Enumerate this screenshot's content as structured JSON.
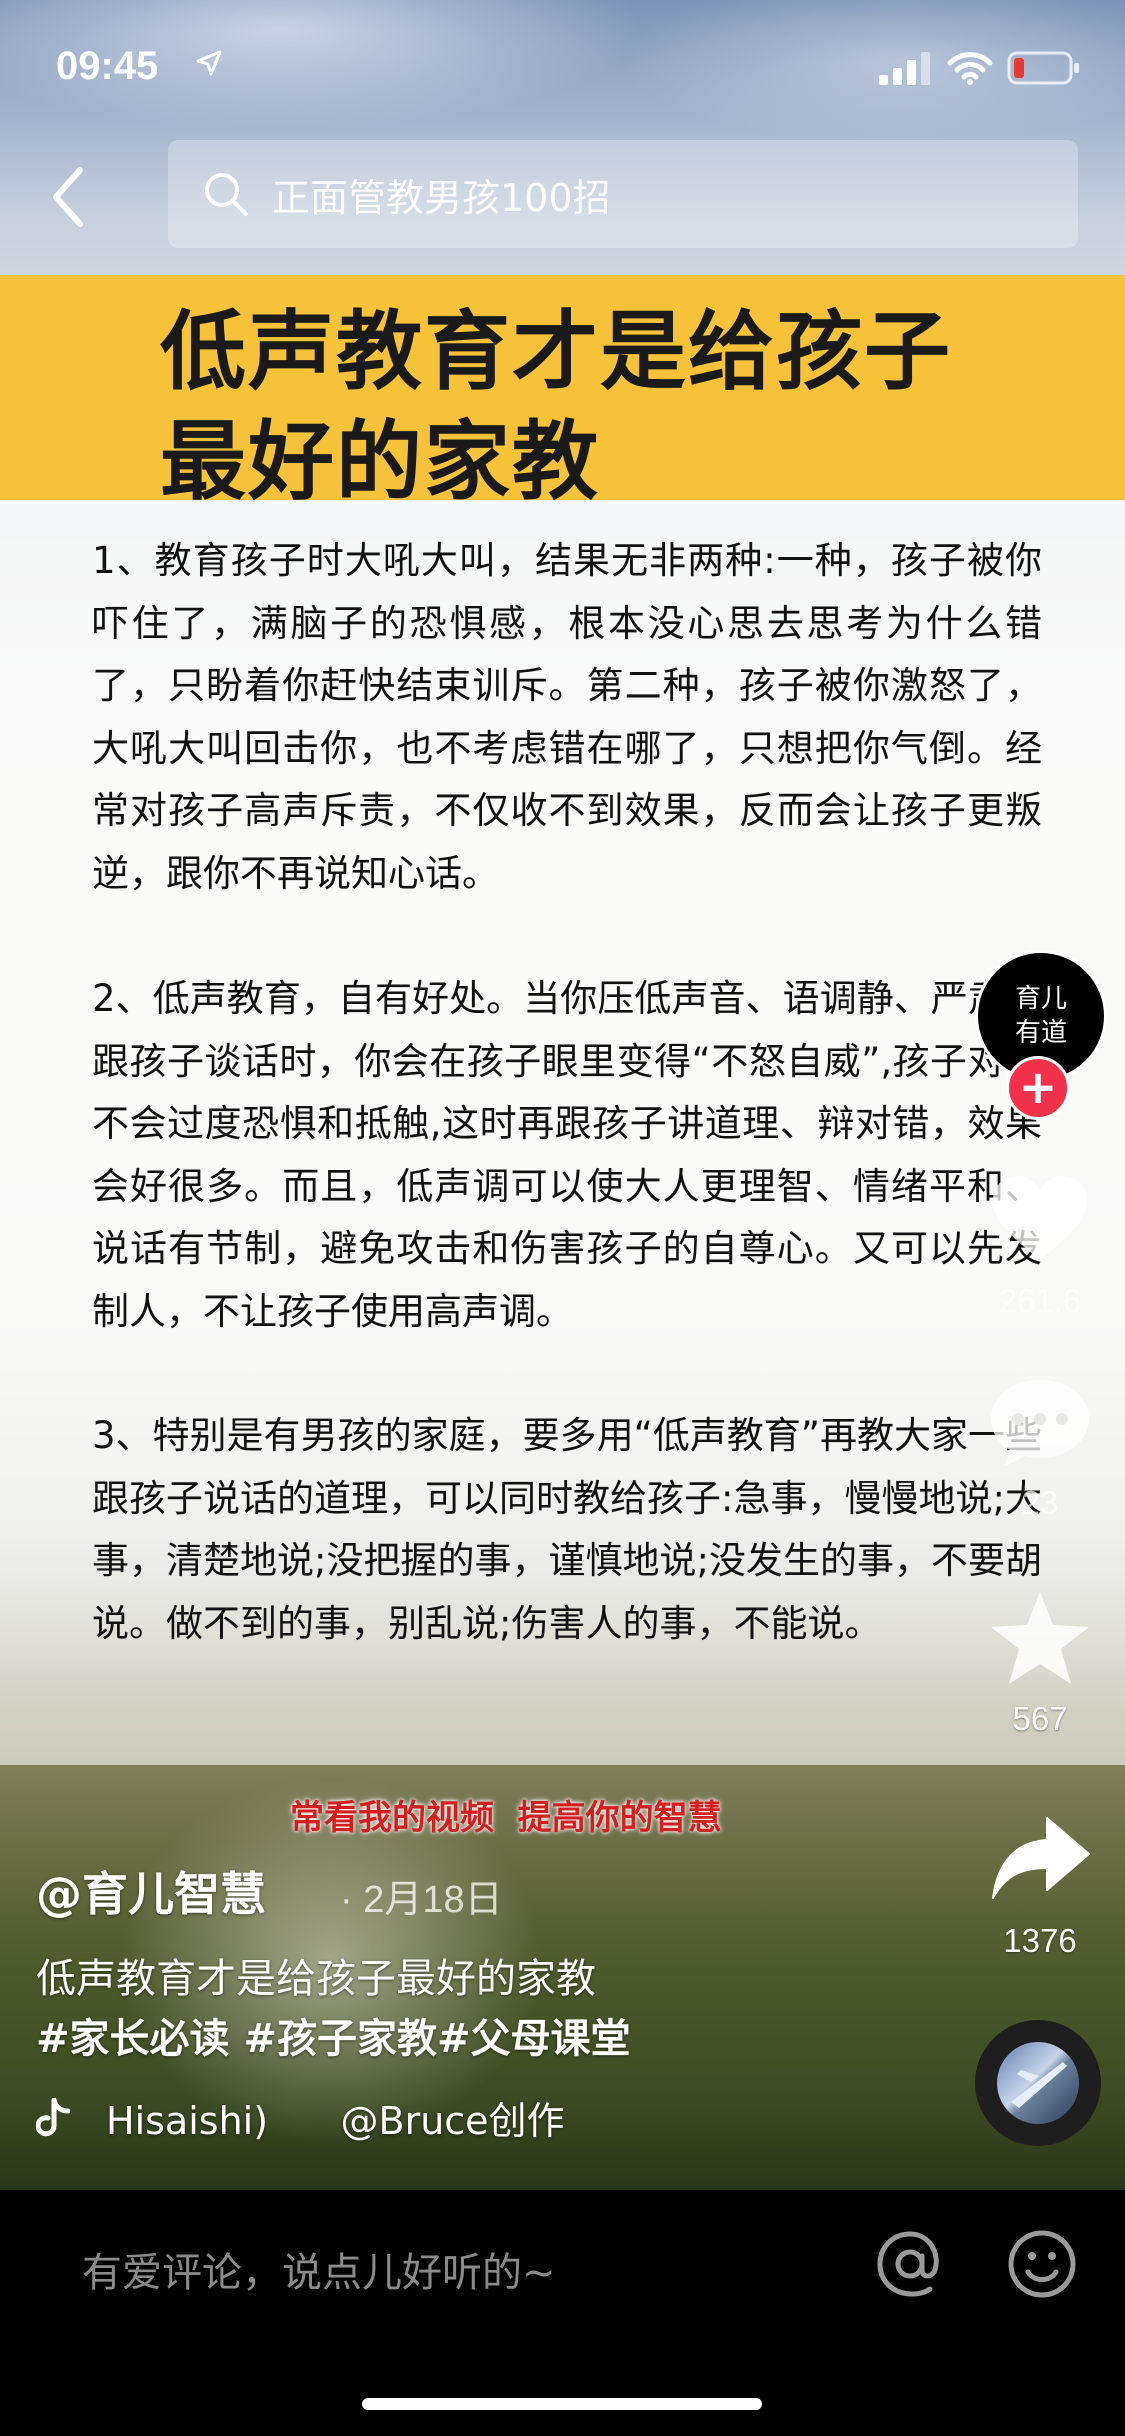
{
  "status": {
    "time": "09:45",
    "icons": [
      "location-arrow-icon",
      "signal-icon",
      "wifi-icon",
      "battery-low-icon"
    ],
    "battery_color": "#e53935"
  },
  "header": {
    "back_icon": "chevron-left-icon",
    "search_placeholder": "正面管教男孩100招"
  },
  "post": {
    "title_line1": "低声教育才是给孩子",
    "title_line2": "最好的家教",
    "title_bg": "#f5c23a",
    "paragraphs": [
      "1、教育孩子时大吼大叫，结果无非两种:一种，孩子被你吓住了，满脑子的恐惧感，根本没心思去思考为什么错了，只盼着你赶快结束训斥。第二种，孩子被你激怒了，大吼大叫回击你，也不考虑错在哪了，只想把你气倒。经常对孩子高声斥责，不仅收不到效果，反而会让孩子更叛逆，跟你不再说知心话。",
      "2、低声教育，自有好处。当你压低声音、语调静、严肃地跟孩子谈话时，你会在孩子眼里变得“不怒自威”,孩子对你不会过度恐惧和抵触,这时再跟孩子讲道理、辩对错，效果会好很多。而且，低声调可以使大人更理智、情绪平和、说话有节制，避免攻击和伤害孩子的自尊心。又可以先发制人，不让孩子使用高声调。",
      "3、特别是有男孩的家庭，要多用“低声教育”再教大家一些跟孩子说话的道理，可以同时教给孩子:急事，慢慢地说;大事，清楚地说;没把握的事，谨慎地说;没发生的事，不要胡说。做不到的事，别乱说;伤害人的事，不能说。"
    ],
    "slogan": "常看我的视频  提高你的智慧",
    "author": "@育儿智慧",
    "date": "· 2月18日",
    "caption": "低声教育才是给孩子最好的家教",
    "tags": "#家长必读 #孩子家教#父母课堂",
    "music": "Hisaishi)      @Bruce创作"
  },
  "rail": {
    "avatar_text_line1": "育儿",
    "avatar_text_line2": "有道",
    "follow_symbol": "+",
    "likes": "261.6",
    "comments": "23",
    "favorites": "567",
    "shares": "1376",
    "accent": "#f2324a"
  },
  "bottom": {
    "comment_placeholder": "有爱评论，说点儿好听的~",
    "at_icon": "at-icon",
    "emoji_icon": "emoji-icon"
  }
}
